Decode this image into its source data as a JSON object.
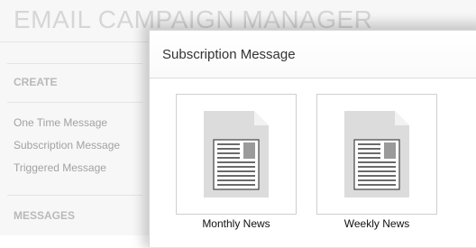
{
  "app": {
    "title": "EMAIL CAMPAIGN MANAGER",
    "sidebar": {
      "create_heading": "CREATE",
      "items": [
        {
          "label": "One Time Message"
        },
        {
          "label": "Subscription Message"
        },
        {
          "label": "Triggered Message"
        }
      ],
      "messages_heading": "MESSAGES"
    }
  },
  "modal": {
    "title": "Subscription Message",
    "templates": [
      {
        "label": "Monthly News",
        "icon": "document-icon"
      },
      {
        "label": "Weekly News",
        "icon": "document-icon"
      }
    ]
  },
  "colors": {
    "title_gray": "#d6d6d6",
    "heading_gray": "#b9b9b9",
    "nav_gray": "#a2a2a2",
    "icon_gray": "#d9d9d9"
  }
}
